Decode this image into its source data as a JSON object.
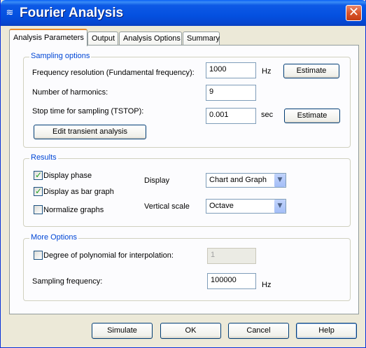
{
  "window": {
    "title": "Fourier Analysis",
    "close_glyph": "✕",
    "icon_glyph": "≋"
  },
  "tabs": [
    "Analysis Parameters",
    "Output",
    "Analysis Options",
    "Summary"
  ],
  "sampling": {
    "legend": "Sampling options",
    "freq_label": "Frequency resolution (Fundamental frequency):",
    "freq_value": "1000",
    "freq_unit": "Hz",
    "freq_estimate": "Estimate",
    "harmonics_label": "Number of harmonics:",
    "harmonics_value": "9",
    "stop_label": "Stop time for sampling (TSTOP):",
    "stop_value": "0.001",
    "stop_unit": "sec",
    "stop_estimate": "Estimate",
    "edit_transient": "Edit transient analysis"
  },
  "results": {
    "legend": "Results",
    "display_phase": "Display phase",
    "display_phase_checked": true,
    "bar_graph": "Display as bar graph",
    "bar_graph_checked": true,
    "normalize": "Normalize graphs",
    "normalize_checked": false,
    "display_label": "Display",
    "display_value": "Chart and Graph",
    "vscale_label": "Vertical scale",
    "vscale_value": "Octave"
  },
  "more": {
    "legend": "More Options",
    "degree_label": "Degree of polynomial for interpolation:",
    "degree_checked": false,
    "degree_value": "1",
    "sampling_label": "Sampling frequency:",
    "sampling_value": "100000",
    "sampling_unit": "Hz"
  },
  "buttons": {
    "simulate": "Simulate",
    "ok": "OK",
    "cancel": "Cancel",
    "help": "Help"
  }
}
